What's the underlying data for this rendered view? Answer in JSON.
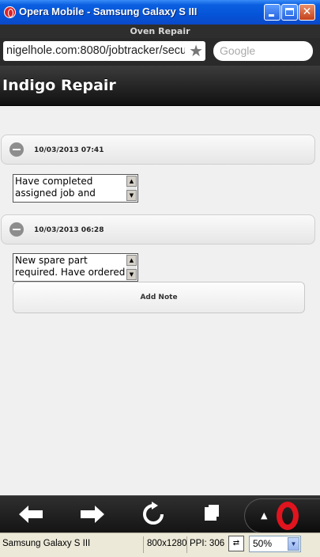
{
  "window": {
    "title": "Opera Mobile - Samsung Galaxy S III",
    "minimize_glyph": "",
    "close_glyph": "✕"
  },
  "browser": {
    "page_title": "Oven Repair",
    "url": "nigelhole.com:8080/jobtracker/secu",
    "search_placeholder": "Google",
    "star_icon": "★"
  },
  "page": {
    "heading": "Indigo Repair",
    "notes": [
      {
        "date": "10/03/2013 07:41",
        "text": "Have completed assigned job and"
      },
      {
        "date": "10/03/2013 06:28",
        "text": "New spare part required. Have ordered"
      }
    ],
    "add_note_label": "Add Note"
  },
  "toolbar": {
    "back_icon": "back-arrow-icon",
    "forward_icon": "forward-arrow-icon",
    "reload_icon": "reload-icon",
    "tabs_icon": "tabs-icon",
    "menu_icon": "opera-logo-icon"
  },
  "statusbar": {
    "device": "Samsung Galaxy S III",
    "resolution": "800x1280",
    "ppi": "PPI: 306",
    "zoom": "50%"
  }
}
